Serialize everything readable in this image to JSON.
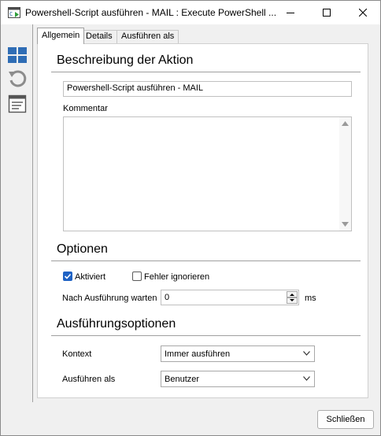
{
  "window": {
    "title": "Powershell-Script ausführen - MAIL : Execute PowerShell ..."
  },
  "tabs": [
    {
      "label": "Allgemein",
      "active": true
    },
    {
      "label": "Details",
      "active": false
    },
    {
      "label": "Ausführen als",
      "active": false
    }
  ],
  "sidebar": {
    "icons": [
      "grid-view-icon",
      "refresh-icon",
      "list-details-icon"
    ]
  },
  "description": {
    "heading": "Beschreibung der Aktion",
    "name_value": "Powershell-Script ausführen - MAIL",
    "comment_label": "Kommentar",
    "comment_value": ""
  },
  "options": {
    "heading": "Optionen",
    "enabled_label": "Aktiviert",
    "enabled_checked": true,
    "ignore_errors_label": "Fehler ignorieren",
    "ignore_errors_checked": false,
    "wait_label": "Nach Ausführung warten",
    "wait_value": "0",
    "wait_unit": "ms"
  },
  "execution": {
    "heading": "Ausführungsoptionen",
    "context_label": "Kontext",
    "context_value": "Immer ausführen",
    "run_as_label": "Ausführen als",
    "run_as_value": "Benutzer"
  },
  "footer": {
    "close_label": "Schließen"
  },
  "colors": {
    "accent": "#1f62c4",
    "icon_blue": "#2f6db5",
    "window_bg": "#f0f0f0"
  }
}
